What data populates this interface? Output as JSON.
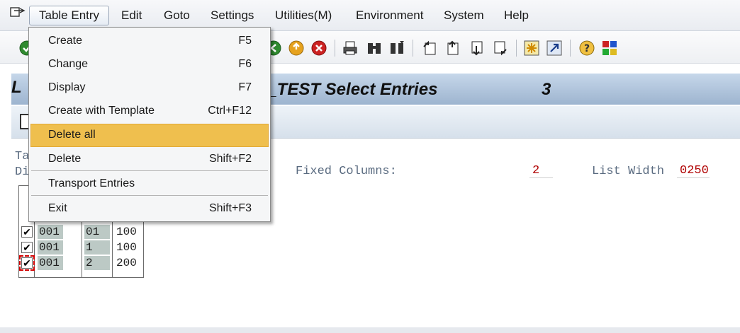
{
  "menubar": {
    "items": [
      {
        "label": "Table Entry",
        "active": true
      },
      {
        "label": "Edit"
      },
      {
        "label": "Goto"
      },
      {
        "label": "Settings"
      },
      {
        "label": "Utilities(M)"
      },
      {
        "label": "Environment"
      },
      {
        "label": "System"
      },
      {
        "label": "Help"
      }
    ]
  },
  "dropdown": {
    "items": [
      {
        "label": "Create",
        "shortcut": "F5"
      },
      {
        "label": "Change",
        "shortcut": "F6"
      },
      {
        "label": "Display",
        "shortcut": "F7"
      },
      {
        "label": "Create with Template",
        "shortcut": "Ctrl+F12"
      },
      {
        "label": "Delete all",
        "shortcut": "",
        "highlighted": true
      },
      {
        "label": "Delete",
        "shortcut": "Shift+F2"
      },
      {
        "label": "Transport Entries",
        "shortcut": ""
      },
      {
        "label": "Exit",
        "shortcut": "Shift+F3"
      }
    ]
  },
  "title": {
    "prefix_visible": "L",
    "text": "AM_TEST Select Entries",
    "count": "3"
  },
  "content": {
    "label_ta": "Ta",
    "label_di": "Di",
    "fixed_columns_label": "Fixed Columns:",
    "fixed_columns_value": "2",
    "list_width_label": "List Width",
    "list_width_value": "0250"
  },
  "table": {
    "rows": [
      {
        "checked": true,
        "c1": "001",
        "c2": "01",
        "c3": "100"
      },
      {
        "checked": true,
        "c1": "001",
        "c2": "1",
        "c3": "100"
      },
      {
        "checked": true,
        "c1": "001",
        "c2": "2",
        "c3": "200",
        "focus": true
      }
    ]
  },
  "icons": [
    "system-menu-icon",
    "green-check-icon",
    "back-icon",
    "exit-icon",
    "cancel-icon",
    "print-icon",
    "find-icon",
    "find-next-icon",
    "first-page-icon",
    "previous-page-icon",
    "next-page-icon",
    "last-page-icon",
    "create-session-icon",
    "shortcut-icon",
    "help-icon",
    "customize-layout-icon"
  ]
}
